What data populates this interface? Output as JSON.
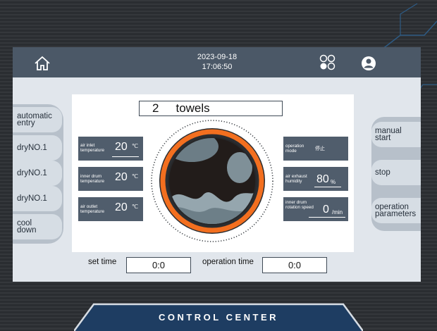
{
  "header": {
    "date": "2023-09-18",
    "time": "17:06:50",
    "home_icon": "home-icon",
    "menu_icon": "circles-grid-icon",
    "user_icon": "user-icon"
  },
  "left_menu": {
    "items": [
      {
        "label": "automatic entry"
      },
      {
        "label": "dryNO.1"
      },
      {
        "label": "dryNO.1"
      },
      {
        "label": "dryNO.1"
      },
      {
        "label": "cool down"
      }
    ]
  },
  "right_menu": {
    "items": [
      {
        "label": "manual start"
      },
      {
        "label": "stop"
      },
      {
        "label": "operation parameters"
      }
    ]
  },
  "main": {
    "load_count": "2",
    "load_unit": "towels",
    "air_inlet": {
      "label": "air inlet temperature",
      "value": "20",
      "unit": "℃"
    },
    "inner_drum_temp": {
      "label": "inner drum temperature",
      "value": "20",
      "unit": "℃"
    },
    "air_outlet": {
      "label": "air outlet temperature",
      "value": "20",
      "unit": "℃"
    },
    "operation_mode": {
      "label": "operation mode",
      "value": "停止"
    },
    "exhaust_humidity": {
      "label": "air exhaust humidity",
      "value": "80",
      "unit": "%"
    },
    "rotation_speed": {
      "label": "inner drum rotation speed",
      "value": "0",
      "unit": "/min"
    }
  },
  "footer": {
    "set_time_label": "set time",
    "set_time_value": "0:0",
    "operation_time_label": "operation time",
    "operation_time_value": "0:0"
  },
  "banner": {
    "title": "CONTROL CENTER"
  },
  "colors": {
    "topbar": "#4b5867",
    "accent": "#f36f1f",
    "info_panel": "#505d6c",
    "background": "#e1e6ec"
  }
}
